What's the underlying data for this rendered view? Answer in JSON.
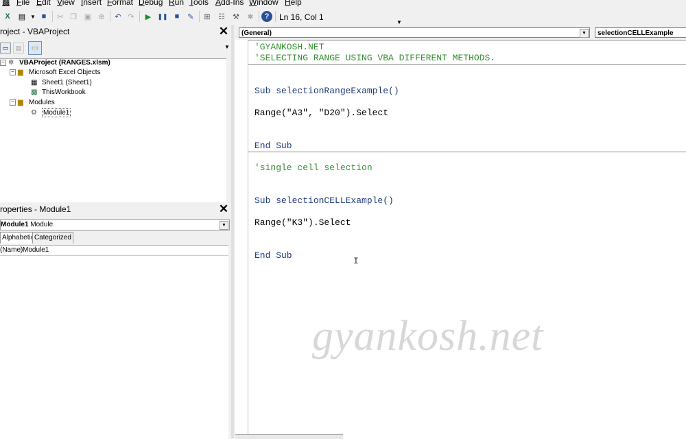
{
  "menubar": {
    "items": [
      "File",
      "Edit",
      "View",
      "Insert",
      "Format",
      "Debug",
      "Run",
      "Tools",
      "Add-Ins",
      "Window",
      "Help"
    ]
  },
  "toolbar": {
    "status": "Ln 16, Col 1"
  },
  "project_explorer": {
    "title": "roject - VBAProject",
    "close_label": "✕",
    "tree": {
      "root": "VBAProject (RANGES.xlsm)",
      "excel_objects": "Microsoft Excel Objects",
      "sheet1": "Sheet1 (Sheet1)",
      "thisworkbook": "ThisWorkbook",
      "modules": "Modules",
      "module1": "Module1"
    }
  },
  "properties": {
    "title": "roperties - Module1",
    "close_label": "✕",
    "object_name": "Module1",
    "object_type": "Module",
    "tabs": [
      "Alphabetic",
      "Categorized"
    ],
    "rows": [
      {
        "name": "(Name)",
        "value": "Module1"
      }
    ]
  },
  "code_window": {
    "object_combo": "(General)",
    "proc_combo": "selectionCELLExample",
    "lines": {
      "c1": "'GYANKOSH.NET",
      "c2": "'SELECTING RANGE USING VBA DIFFERENT METHODS.",
      "sub1": "Sub selectionRangeExample()",
      "stmt1": "Range(\"A3\", \"D20\").Select",
      "end1": "End Sub",
      "c3": "'single cell selection",
      "sub2": "Sub selectionCELLExample()",
      "stmt2": "Range(\"K3\").Select",
      "end2": "End Sub"
    }
  },
  "watermark": "gyankosh.net",
  "colors": {
    "keyword": "#1e3a78",
    "comment": "#2f8f2f"
  }
}
